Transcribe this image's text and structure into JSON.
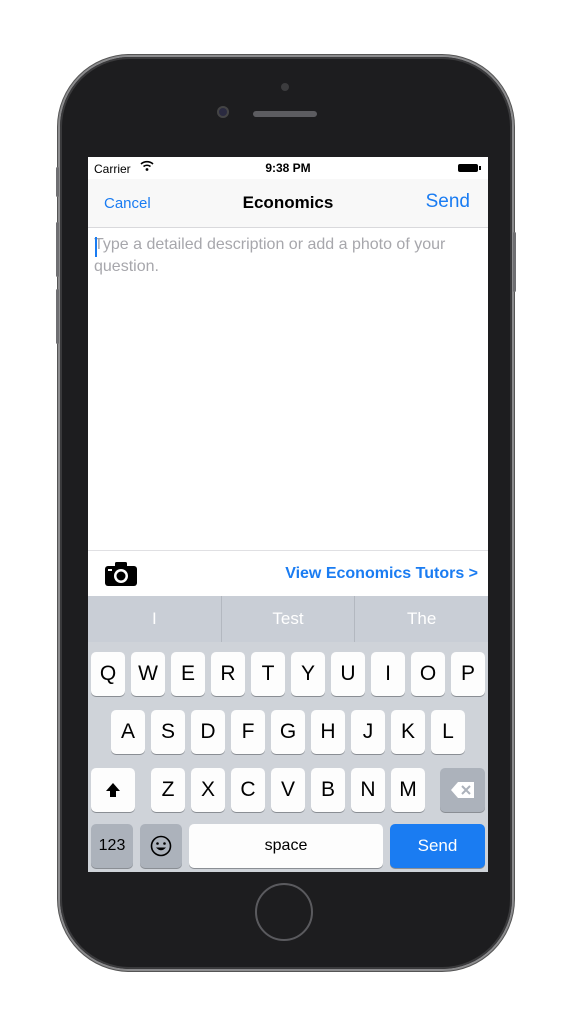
{
  "status_bar": {
    "carrier": "Carrier",
    "time": "9:38 PM"
  },
  "nav": {
    "cancel_label": "Cancel",
    "title": "Economics",
    "send_label": "Send"
  },
  "compose": {
    "placeholder": "Type a detailed description or add a photo of your question.",
    "value": ""
  },
  "toolbar": {
    "camera_icon": "camera-icon",
    "tutors_link": "View Economics Tutors >"
  },
  "suggestions": [
    "I",
    "Test",
    "The"
  ],
  "keyboard": {
    "row1": [
      "Q",
      "W",
      "E",
      "R",
      "T",
      "Y",
      "U",
      "I",
      "O",
      "P"
    ],
    "row2": [
      "A",
      "S",
      "D",
      "F",
      "G",
      "H",
      "J",
      "K",
      "L"
    ],
    "row3": [
      "Z",
      "X",
      "C",
      "V",
      "B",
      "N",
      "M"
    ],
    "numbers_label": "123",
    "space_label": "space",
    "send_label": "Send",
    "shift_icon": "shift-icon",
    "delete_icon": "delete-icon",
    "emoji_icon": "emoji-icon"
  },
  "colors": {
    "accent": "#1a7cf2",
    "keyboard_bg": "#cfd3d9",
    "suggest_bg": "#c9ced6"
  }
}
